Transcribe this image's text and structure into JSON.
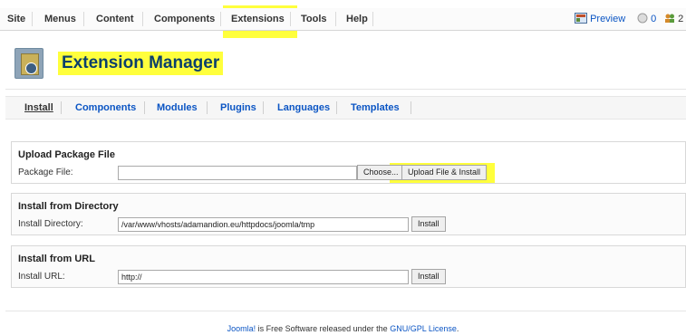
{
  "menu": {
    "items": [
      "Site",
      "Menus",
      "Content",
      "Components",
      "Extensions",
      "Tools",
      "Help"
    ]
  },
  "status": {
    "preview": "Preview",
    "messages_count": "0",
    "users_count": "2"
  },
  "header": {
    "title": "Extension Manager"
  },
  "submenu": {
    "tabs": [
      "Install",
      "Components",
      "Modules",
      "Plugins",
      "Languages",
      "Templates"
    ]
  },
  "upload": {
    "title": "Upload Package File",
    "label": "Package File:",
    "browse_button": "Choose...",
    "submit_button": "Upload File & Install"
  },
  "directory": {
    "title": "Install from Directory",
    "label": "Install Directory:",
    "value": "/var/www/vhosts/adamandion.eu/httpdocs/joomla/tmp",
    "button": "Install"
  },
  "url": {
    "title": "Install from URL",
    "label": "Install URL:",
    "value": "http://",
    "button": "Install"
  },
  "footer": {
    "link_joomla": "Joomla!",
    "text": " is Free Software released under the ",
    "link_license": "GNU/GPL License",
    "end": "."
  },
  "colors": {
    "highlight": "#ffff3c",
    "link": "#0b55c4",
    "title": "#0b3f6b"
  }
}
